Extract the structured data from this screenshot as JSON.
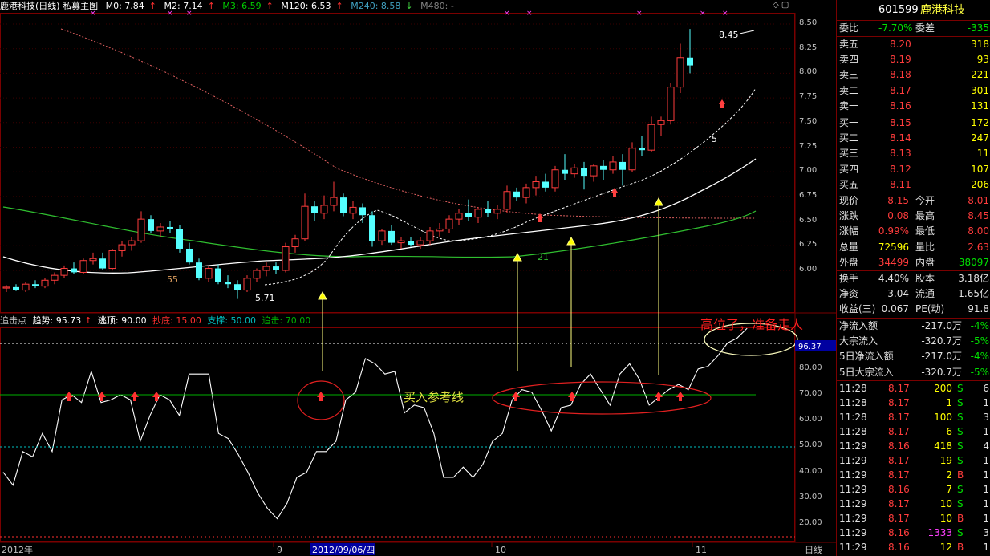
{
  "chart_header": {
    "title": "鹿港科技(日线) 私募主图",
    "ma": [
      {
        "label": "M0: 7.84",
        "arrow": "↑",
        "color": "#ffffff"
      },
      {
        "label": "M2: 7.14",
        "arrow": "↑",
        "color": "#ffffff"
      },
      {
        "label": "M3: 6.59",
        "arrow": "↑",
        "color": "#00d000"
      },
      {
        "label": "M120: 6.53",
        "arrow": "↑",
        "color": "#ffffff"
      },
      {
        "label": "M240: 8.58",
        "arrow": "↓",
        "color": "#40a0c0"
      },
      {
        "label": "M480: -",
        "arrow": "",
        "color": "#808080"
      }
    ]
  },
  "indicator_header": {
    "label": "追击点",
    "items": [
      {
        "text": "趋势: 95.73",
        "arrow": "↑",
        "color": "#ffffff"
      },
      {
        "text": "逃顶: 90.00",
        "arrow": "",
        "color": "#ffffff"
      },
      {
        "text": "抄底: 15.00",
        "arrow": "",
        "color": "#ff3030"
      },
      {
        "text": "支撑: 50.00",
        "arrow": "",
        "color": "#00c0c0"
      },
      {
        "text": "追击: 70.00",
        "arrow": "",
        "color": "#00b000"
      }
    ]
  },
  "price_axis": [
    "8.50",
    "8.25",
    "8.00",
    "7.75",
    "7.50",
    "7.25",
    "7.00",
    "6.75",
    "6.50",
    "6.25",
    "6.00"
  ],
  "ind_axis": [
    "80.00",
    "70.00",
    "60.00",
    "50.00",
    "40.00",
    "30.00",
    "20.00"
  ],
  "ind_current": "96.37",
  "x_axis": {
    "labels": [
      "2012年",
      "9",
      "2012/09/06/四",
      "10",
      "11"
    ],
    "period": "日线"
  },
  "annotations": {
    "top_label": "8.45",
    "low_label": "5.71",
    "num_55": "55",
    "num_21": "21",
    "num_5": "5",
    "buy_line": "买入参考线",
    "high_warning": "高位了，准备走人"
  },
  "chart_data": {
    "type": "candlestick",
    "ohlc": [
      [
        5.82,
        5.85,
        5.78,
        5.83
      ],
      [
        5.83,
        5.86,
        5.79,
        5.8
      ],
      [
        5.8,
        5.88,
        5.78,
        5.86
      ],
      [
        5.86,
        5.9,
        5.82,
        5.84
      ],
      [
        5.84,
        5.92,
        5.82,
        5.9
      ],
      [
        5.9,
        5.98,
        5.86,
        5.95
      ],
      [
        5.95,
        6.05,
        5.92,
        6.02
      ],
      [
        6.02,
        6.08,
        5.96,
        5.98
      ],
      [
        5.98,
        6.12,
        5.96,
        6.1
      ],
      [
        6.1,
        6.18,
        6.06,
        6.12
      ],
      [
        6.12,
        6.18,
        6.0,
        6.02
      ],
      [
        6.02,
        6.22,
        6.0,
        6.2
      ],
      [
        6.2,
        6.3,
        6.14,
        6.26
      ],
      [
        6.26,
        6.34,
        6.2,
        6.3
      ],
      [
        6.3,
        6.6,
        6.28,
        6.52
      ],
      [
        6.52,
        6.56,
        6.38,
        6.4
      ],
      [
        6.4,
        6.48,
        6.34,
        6.44
      ],
      [
        6.44,
        6.5,
        6.38,
        6.42
      ],
      [
        6.42,
        6.46,
        6.18,
        6.22
      ],
      [
        6.22,
        6.28,
        6.06,
        6.08
      ],
      [
        6.08,
        6.12,
        5.9,
        5.92
      ],
      [
        5.92,
        6.05,
        5.88,
        6.02
      ],
      [
        6.02,
        6.06,
        5.86,
        5.88
      ],
      [
        5.88,
        5.95,
        5.82,
        5.86
      ],
      [
        5.86,
        5.9,
        5.71,
        5.8
      ],
      [
        5.8,
        5.95,
        5.78,
        5.92
      ],
      [
        5.92,
        6.02,
        5.88,
        6.0
      ],
      [
        6.0,
        6.08,
        5.94,
        6.04
      ],
      [
        6.04,
        6.08,
        5.96,
        6.0
      ],
      [
        6.0,
        6.28,
        5.98,
        6.24
      ],
      [
        6.24,
        6.36,
        6.18,
        6.32
      ],
      [
        6.32,
        6.78,
        6.3,
        6.65
      ],
      [
        6.65,
        6.7,
        6.5,
        6.58
      ],
      [
        6.58,
        6.76,
        6.52,
        6.66
      ],
      [
        6.66,
        6.9,
        6.6,
        6.74
      ],
      [
        6.74,
        6.78,
        6.55,
        6.58
      ],
      [
        6.58,
        6.7,
        6.52,
        6.64
      ],
      [
        6.64,
        6.68,
        6.48,
        6.56
      ],
      [
        6.56,
        6.6,
        6.24,
        6.3
      ],
      [
        6.3,
        6.42,
        6.26,
        6.4
      ],
      [
        6.4,
        6.46,
        6.26,
        6.28
      ],
      [
        6.28,
        6.34,
        6.22,
        6.3
      ],
      [
        6.3,
        6.34,
        6.24,
        6.26
      ],
      [
        6.26,
        6.34,
        6.22,
        6.3
      ],
      [
        6.3,
        6.44,
        6.26,
        6.4
      ],
      [
        6.4,
        6.48,
        6.34,
        6.42
      ],
      [
        6.42,
        6.56,
        6.38,
        6.52
      ],
      [
        6.52,
        6.62,
        6.46,
        6.58
      ],
      [
        6.58,
        6.72,
        6.5,
        6.54
      ],
      [
        6.54,
        6.64,
        6.48,
        6.62
      ],
      [
        6.62,
        6.7,
        6.54,
        6.58
      ],
      [
        6.58,
        6.66,
        6.52,
        6.62
      ],
      [
        6.62,
        6.86,
        6.58,
        6.8
      ],
      [
        6.8,
        6.84,
        6.7,
        6.74
      ],
      [
        6.74,
        6.88,
        6.68,
        6.84
      ],
      [
        6.84,
        6.96,
        6.76,
        6.9
      ],
      [
        6.9,
        6.98,
        6.8,
        6.84
      ],
      [
        6.84,
        7.06,
        6.8,
        7.02
      ],
      [
        7.02,
        7.18,
        6.92,
        6.98
      ],
      [
        6.98,
        7.08,
        6.94,
        7.04
      ],
      [
        7.04,
        7.1,
        6.82,
        6.96
      ],
      [
        6.96,
        7.08,
        6.9,
        7.06
      ],
      [
        7.06,
        7.12,
        6.92,
        7.02
      ],
      [
        7.02,
        7.16,
        6.98,
        7.1
      ],
      [
        7.1,
        7.18,
        6.86,
        7.02
      ],
      [
        7.02,
        7.3,
        7.0,
        7.24
      ],
      [
        7.24,
        7.36,
        7.16,
        7.22
      ],
      [
        7.22,
        7.56,
        7.2,
        7.48
      ],
      [
        7.48,
        7.56,
        7.36,
        7.52
      ],
      [
        7.52,
        7.9,
        7.48,
        7.86
      ],
      [
        7.86,
        8.3,
        7.8,
        8.16
      ],
      [
        8.16,
        8.45,
        8.0,
        8.08
      ]
    ],
    "ind_values": [
      40,
      35,
      48,
      46,
      55,
      48,
      68,
      70,
      67,
      79,
      67,
      68,
      70,
      68,
      52,
      62,
      70,
      68,
      62,
      78,
      78,
      78,
      55,
      53,
      47,
      40,
      32,
      26,
      22,
      28,
      38,
      40,
      48,
      48,
      52,
      68,
      71,
      84,
      82,
      78,
      79,
      63,
      66,
      65,
      55,
      38,
      38,
      42,
      38,
      43,
      52,
      55,
      68,
      72,
      71,
      64,
      56,
      65,
      66,
      74,
      78,
      72,
      66,
      78,
      82,
      76,
      66,
      69,
      72,
      74,
      72,
      80,
      81,
      85,
      90,
      92,
      95.73
    ]
  },
  "quote": {
    "code": "601599",
    "name": "鹿港科技",
    "weibi": {
      "label": "委比",
      "value": "-7.70%",
      "label2": "委差",
      "value2": "-335"
    },
    "sells": [
      {
        "label": "卖五",
        "price": "8.20",
        "vol": "318"
      },
      {
        "label": "卖四",
        "price": "8.19",
        "vol": "93"
      },
      {
        "label": "卖三",
        "price": "8.18",
        "vol": "221"
      },
      {
        "label": "卖二",
        "price": "8.17",
        "vol": "301"
      },
      {
        "label": "卖一",
        "price": "8.16",
        "vol": "131"
      }
    ],
    "buys": [
      {
        "label": "买一",
        "price": "8.15",
        "vol": "172"
      },
      {
        "label": "买二",
        "price": "8.14",
        "vol": "247"
      },
      {
        "label": "买三",
        "price": "8.13",
        "vol": "11"
      },
      {
        "label": "买四",
        "price": "8.12",
        "vol": "107"
      },
      {
        "label": "买五",
        "price": "8.11",
        "vol": "206"
      }
    ],
    "stats": [
      {
        "l1": "现价",
        "v1": "8.15",
        "c1": "red",
        "l2": "今开",
        "v2": "8.01",
        "c2": "red"
      },
      {
        "l1": "涨跌",
        "v1": "0.08",
        "c1": "red",
        "l2": "最高",
        "v2": "8.45",
        "c2": "red"
      },
      {
        "l1": "涨幅",
        "v1": "0.99%",
        "c1": "red",
        "l2": "最低",
        "v2": "8.00",
        "c2": "red"
      },
      {
        "l1": "总量",
        "v1": "72596",
        "c1": "yellow",
        "l2": "量比",
        "v2": "2.63",
        "c2": "red"
      },
      {
        "l1": "外盘",
        "v1": "34499",
        "c1": "red",
        "l2": "内盘",
        "v2": "38097",
        "c2": "green"
      }
    ],
    "fund": [
      {
        "l1": "换手",
        "v1": "4.40%",
        "l2": "股本",
        "v2": "3.18亿"
      },
      {
        "l1": "净资",
        "v1": "3.04",
        "l2": "流通",
        "v2": "1.65亿"
      },
      {
        "l1": "收益(三)",
        "v1": "0.067",
        "l2": "PE(动)",
        "v2": "91.8"
      }
    ],
    "flows": [
      {
        "label": "净流入额",
        "value": "-217.0万",
        "pct": "-4%"
      },
      {
        "label": "大宗流入",
        "value": "-320.7万",
        "pct": "-5%"
      },
      {
        "label": "5日净流入额",
        "value": "-217.0万",
        "pct": "-4%"
      },
      {
        "label": "5日大宗流入",
        "value": "-320.7万",
        "pct": "-5%"
      }
    ],
    "ticks": [
      {
        "time": "11:28",
        "price": "8.17",
        "vol": "200",
        "side": "S",
        "n": "6"
      },
      {
        "time": "11:28",
        "price": "8.17",
        "vol": "1",
        "side": "S",
        "n": "1"
      },
      {
        "time": "11:28",
        "price": "8.17",
        "vol": "100",
        "side": "S",
        "n": "3"
      },
      {
        "time": "11:28",
        "price": "8.17",
        "vol": "6",
        "side": "S",
        "n": "1"
      },
      {
        "time": "11:29",
        "price": "8.16",
        "vol": "418",
        "side": "S",
        "n": "4"
      },
      {
        "time": "11:29",
        "price": "8.17",
        "vol": "19",
        "side": "S",
        "n": "1"
      },
      {
        "time": "11:29",
        "price": "8.17",
        "vol": "2",
        "side": "B",
        "n": "1"
      },
      {
        "time": "11:29",
        "price": "8.16",
        "vol": "7",
        "side": "S",
        "n": "1"
      },
      {
        "time": "11:29",
        "price": "8.17",
        "vol": "10",
        "side": "S",
        "n": "1"
      },
      {
        "time": "11:29",
        "price": "8.17",
        "vol": "10",
        "side": "B",
        "n": "1"
      },
      {
        "time": "11:29",
        "price": "8.16",
        "vol": "1333",
        "side": "S",
        "n": "3"
      },
      {
        "time": "11:29",
        "price": "8.16",
        "vol": "12",
        "side": "B",
        "n": "1"
      }
    ]
  }
}
